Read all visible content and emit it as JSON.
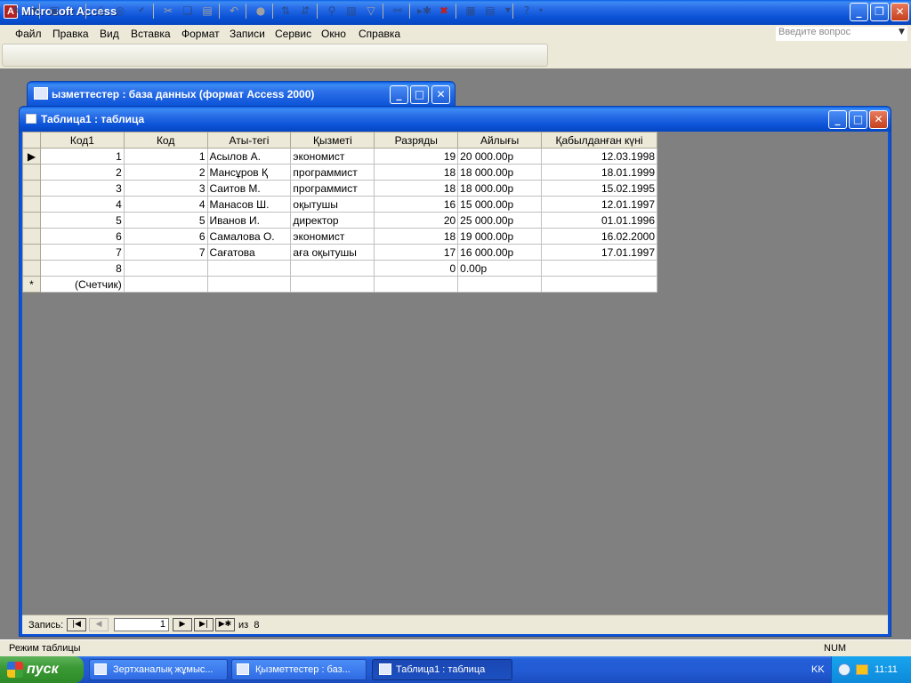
{
  "app": {
    "title": "Microsoft Access",
    "icon": "access-icon"
  },
  "menu": [
    "Файл",
    "Правка",
    "Вид",
    "Вставка",
    "Формат",
    "Записи",
    "Сервис",
    "Окно",
    "Справка"
  ],
  "ask_placeholder": "Введите вопрос",
  "toolbar_icons": [
    "view-design-icon",
    "save-icon",
    "search-file-icon",
    "print-icon",
    "print-preview-icon",
    "spelling-icon",
    "cut-icon",
    "copy-icon",
    "paste-icon",
    "undo-icon",
    "insert-hyperlink-icon",
    "sort-ascending-icon",
    "sort-descending-icon",
    "filter-by-selection-icon",
    "filter-by-form-icon",
    "apply-filter-icon",
    "find-icon",
    "new-record-icon",
    "delete-record-icon",
    "database-window-icon",
    "new-object-icon",
    "help-icon"
  ],
  "db_window": {
    "title": "ызметтестер : база данных (формат Access 2000)"
  },
  "table_window": {
    "title": "Таблица1 : таблица"
  },
  "grid": {
    "columns": [
      "Код1",
      "Код",
      "Аты-тегі",
      "Қызметі",
      "Разряды",
      "Айлығы",
      "Қабылданған күні"
    ],
    "rows": [
      [
        "1",
        "1",
        "Асылов А.",
        "экономист",
        "19",
        "20 000.00р",
        "12.03.1998"
      ],
      [
        "2",
        "2",
        "Мансұров Қ",
        "программист",
        "18",
        "18 000.00р",
        "18.01.1999"
      ],
      [
        "3",
        "3",
        "Саитов М.",
        "программист",
        "18",
        "18 000.00р",
        "15.02.1995"
      ],
      [
        "4",
        "4",
        "Манасов Ш.",
        "оқытушы",
        "16",
        "15 000.00р",
        "12.01.1997"
      ],
      [
        "5",
        "5",
        "Иванов И.",
        "директор",
        "20",
        "25 000.00р",
        "01.01.1996"
      ],
      [
        "6",
        "6",
        "Самалова О.",
        "экономист",
        "18",
        "19 000.00р",
        "16.02.2000"
      ],
      [
        "7",
        "7",
        "Сағатова",
        "аға оқытушы",
        "17",
        "16 000.00р",
        "17.01.1997"
      ],
      [
        "8",
        "",
        "",
        "",
        "0",
        "0.00р",
        ""
      ]
    ],
    "new_row_placeholder": "(Счетчик)",
    "new_row_marker": "*",
    "current_marker": "▶"
  },
  "navigator": {
    "label": "Запись:",
    "current": "1",
    "of_label": "из",
    "total": "8"
  },
  "status": {
    "mode": "Режим таблицы",
    "num": "NUM"
  },
  "taskbar": {
    "start": "пуск",
    "buttons": [
      "Зертханалық жұмыс...",
      "Қызметтестер : баз...",
      "Таблица1 : таблица"
    ],
    "lang": "KK",
    "clock": "11:11"
  }
}
